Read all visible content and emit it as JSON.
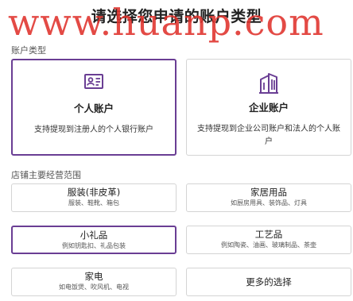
{
  "header": {
    "title": "请选择您申请的账户类型",
    "watermark": "www.huanp.com"
  },
  "account_type": {
    "label": "账户类型",
    "options": [
      {
        "title": "个人账户",
        "desc": "支持提现到注册人的个人银行账户",
        "icon": "id-card-icon",
        "selected": true
      },
      {
        "title": "企业账户",
        "desc": "支持提现到企业公司账户和法人的个人账户",
        "icon": "office-building-icon",
        "selected": false
      }
    ]
  },
  "business_scope": {
    "label": "店铺主要经营范围",
    "items": [
      {
        "title": "服装(非皮革)",
        "sub": "服装、鞋靴、箱包",
        "selected": false
      },
      {
        "title": "家居用品",
        "sub": "如厨房用具、装饰品、灯具",
        "selected": false
      },
      {
        "title": "小礼品",
        "sub": "例如钥匙扣、礼品包装",
        "selected": true
      },
      {
        "title": "工艺品",
        "sub": "例如陶瓷、油画、玻璃制品、茶壶",
        "selected": false
      },
      {
        "title": "家电",
        "sub": "如电饭煲、吹风机、电视",
        "selected": false
      },
      {
        "title": "更多的选择",
        "sub": "",
        "selected": false
      }
    ]
  },
  "colors": {
    "accent": "#6a3e94",
    "watermark": "#e0322c",
    "border": "#d4d4d4"
  }
}
